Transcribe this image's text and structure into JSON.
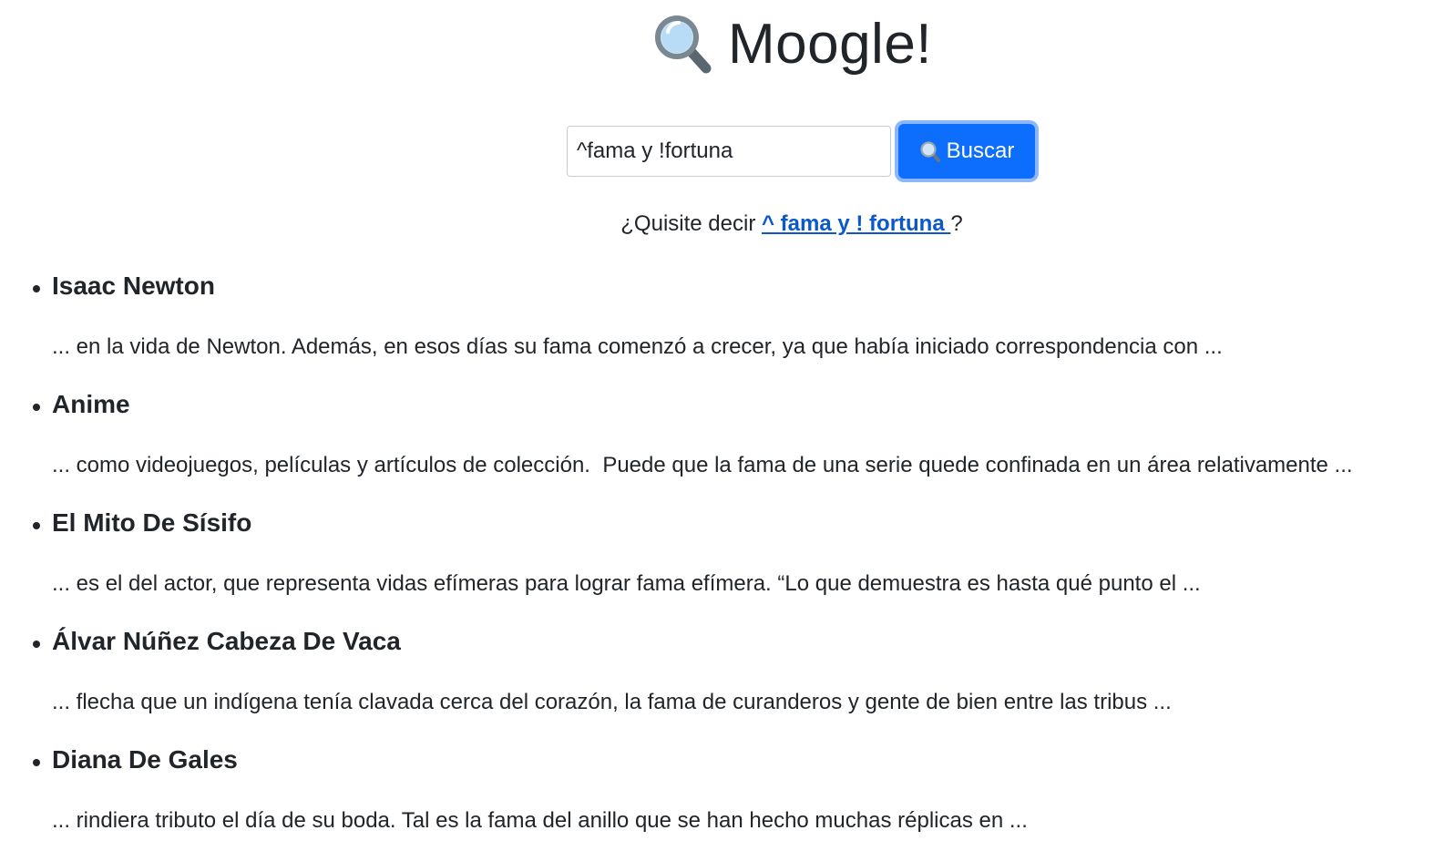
{
  "header": {
    "title": "Moogle!",
    "logo_icon": "magnifying-glass-icon"
  },
  "search": {
    "value": "^fama y !fortuna",
    "button_label": "Buscar",
    "button_icon": "magnifying-glass-icon",
    "button_color": "#0d6efd"
  },
  "suggestion": {
    "prefix": "¿Quisite decir ",
    "link_text": "^ fama y ! fortuna ",
    "suffix": "?",
    "link_color": "#0a58ca"
  },
  "results": [
    {
      "title": "Isaac Newton",
      "snippet": "... en la vida de Newton. Además, en esos días su fama comenzó a crecer, ya que había iniciado correspondencia con ..."
    },
    {
      "title": "Anime",
      "snippet": "... como videojuegos, películas y artículos de colección.  Puede que la fama de una serie quede confinada en un área relativamente ..."
    },
    {
      "title": "El Mito De Sísifo",
      "snippet": "... es el del actor, que representa vidas efímeras para lograr fama efímera. “Lo que demuestra es hasta qué punto el ..."
    },
    {
      "title": "Álvar Núñez Cabeza De Vaca",
      "snippet": "... flecha que un indígena tenía clavada cerca del corazón, la fama de curanderos y gente de bien entre las tribus ..."
    },
    {
      "title": "Diana De Gales",
      "snippet": "... rindiera tributo el día de su boda. Tal es la fama del anillo que se han hecho muchas réplicas en ..."
    }
  ]
}
